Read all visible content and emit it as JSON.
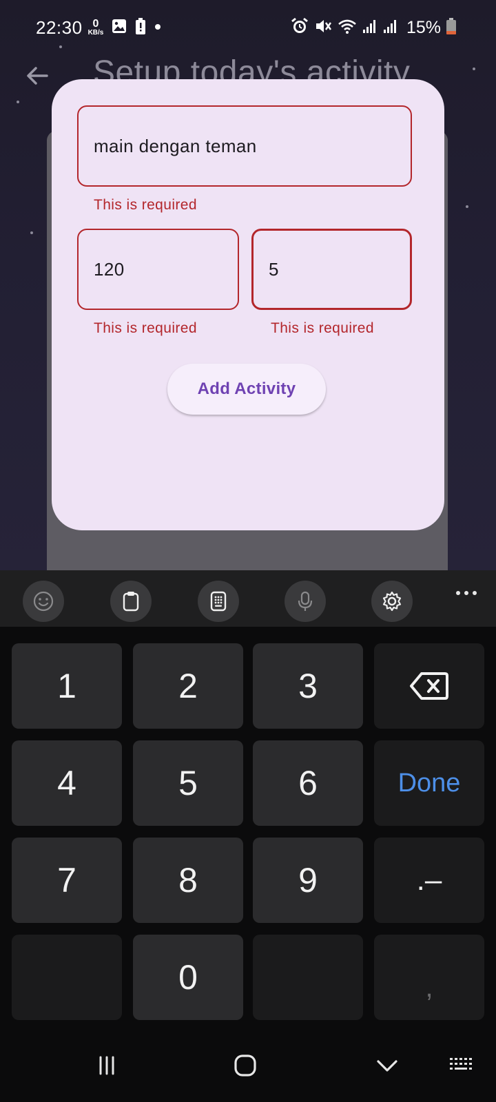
{
  "status_bar": {
    "time": "22:30",
    "net_speed_value": "0",
    "net_speed_unit": "KB/s",
    "battery_percent": "15%"
  },
  "app_bar": {
    "title": "Setup today's activity"
  },
  "form": {
    "activity_name_value": "main dengan teman",
    "activity_name_error": "This is required",
    "minutes_value": "120",
    "minutes_error": "This is required",
    "points_value": "5",
    "points_error": "This is required",
    "add_button_label": "Add Activity"
  },
  "keyboard": {
    "toolbar": [
      "emoji-icon",
      "clipboard-icon",
      "keypad-icon",
      "mic-icon",
      "settings-icon",
      "more-icon"
    ],
    "keys": {
      "k1": "1",
      "k2": "2",
      "k3": "3",
      "k4": "4",
      "k5": "5",
      "k6": "6",
      "k7": "7",
      "k8": "8",
      "k9": "9",
      "k0": "0",
      "done": "Done",
      "dot_dash": ".–",
      "comma": ","
    },
    "done_color": "#4d8fe8"
  },
  "colors": {
    "error": "#b3262b",
    "dialog_bg": "#efe3f5",
    "button_text": "#6f42b2"
  }
}
